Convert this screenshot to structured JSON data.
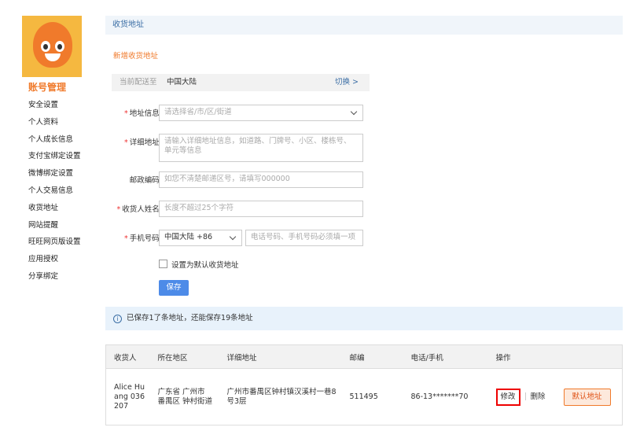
{
  "sidebar": {
    "title": "账号管理",
    "items": [
      "安全设置",
      "个人资料",
      "个人成长信息",
      "支付宝绑定设置",
      "微博绑定设置",
      "个人交易信息",
      "收货地址",
      "网站提醒",
      "旺旺网页版设置",
      "应用授权",
      "分享绑定"
    ]
  },
  "header": {
    "title": "收货地址"
  },
  "new_address": "新增收货地址",
  "region": {
    "label": "当前配送至",
    "value": "中国大陆",
    "switch": "切换 >"
  },
  "form": {
    "address_info": {
      "label": "地址信息:",
      "placeholder": "请选择省/市/区/街道"
    },
    "detail": {
      "label": "详细地址:",
      "placeholder": "请输入详细地址信息，如道路、门牌号、小区、楼栋号、单元等信息"
    },
    "postcode": {
      "label": "邮政编码:",
      "placeholder": "如您不清楚邮递区号，请填写000000"
    },
    "receiver": {
      "label": "收货人姓名:",
      "placeholder": "长度不超过25个字符"
    },
    "phone": {
      "label": "手机号码:",
      "country": "中国大陆 +86",
      "placeholder": "电话号码、手机号码必须填一项"
    },
    "default_checkbox": "设置为默认收货地址",
    "save": "保存"
  },
  "info": {
    "text": "已保存1了条地址，还能保存19条地址"
  },
  "table": {
    "headers": [
      "收货人",
      "所在地区",
      "详细地址",
      "邮编",
      "电话/手机",
      "操作",
      ""
    ],
    "row": {
      "receiver": "Alice Huang 036207",
      "region": "广东省 广州市 番禺区 钟村街道",
      "detail": "广州市番禺区钟村镇汉溪村一巷8号3层",
      "postcode": "511495",
      "phone": "86-13*******70",
      "edit": "修改",
      "delete": "删除",
      "default": "默认地址"
    }
  }
}
